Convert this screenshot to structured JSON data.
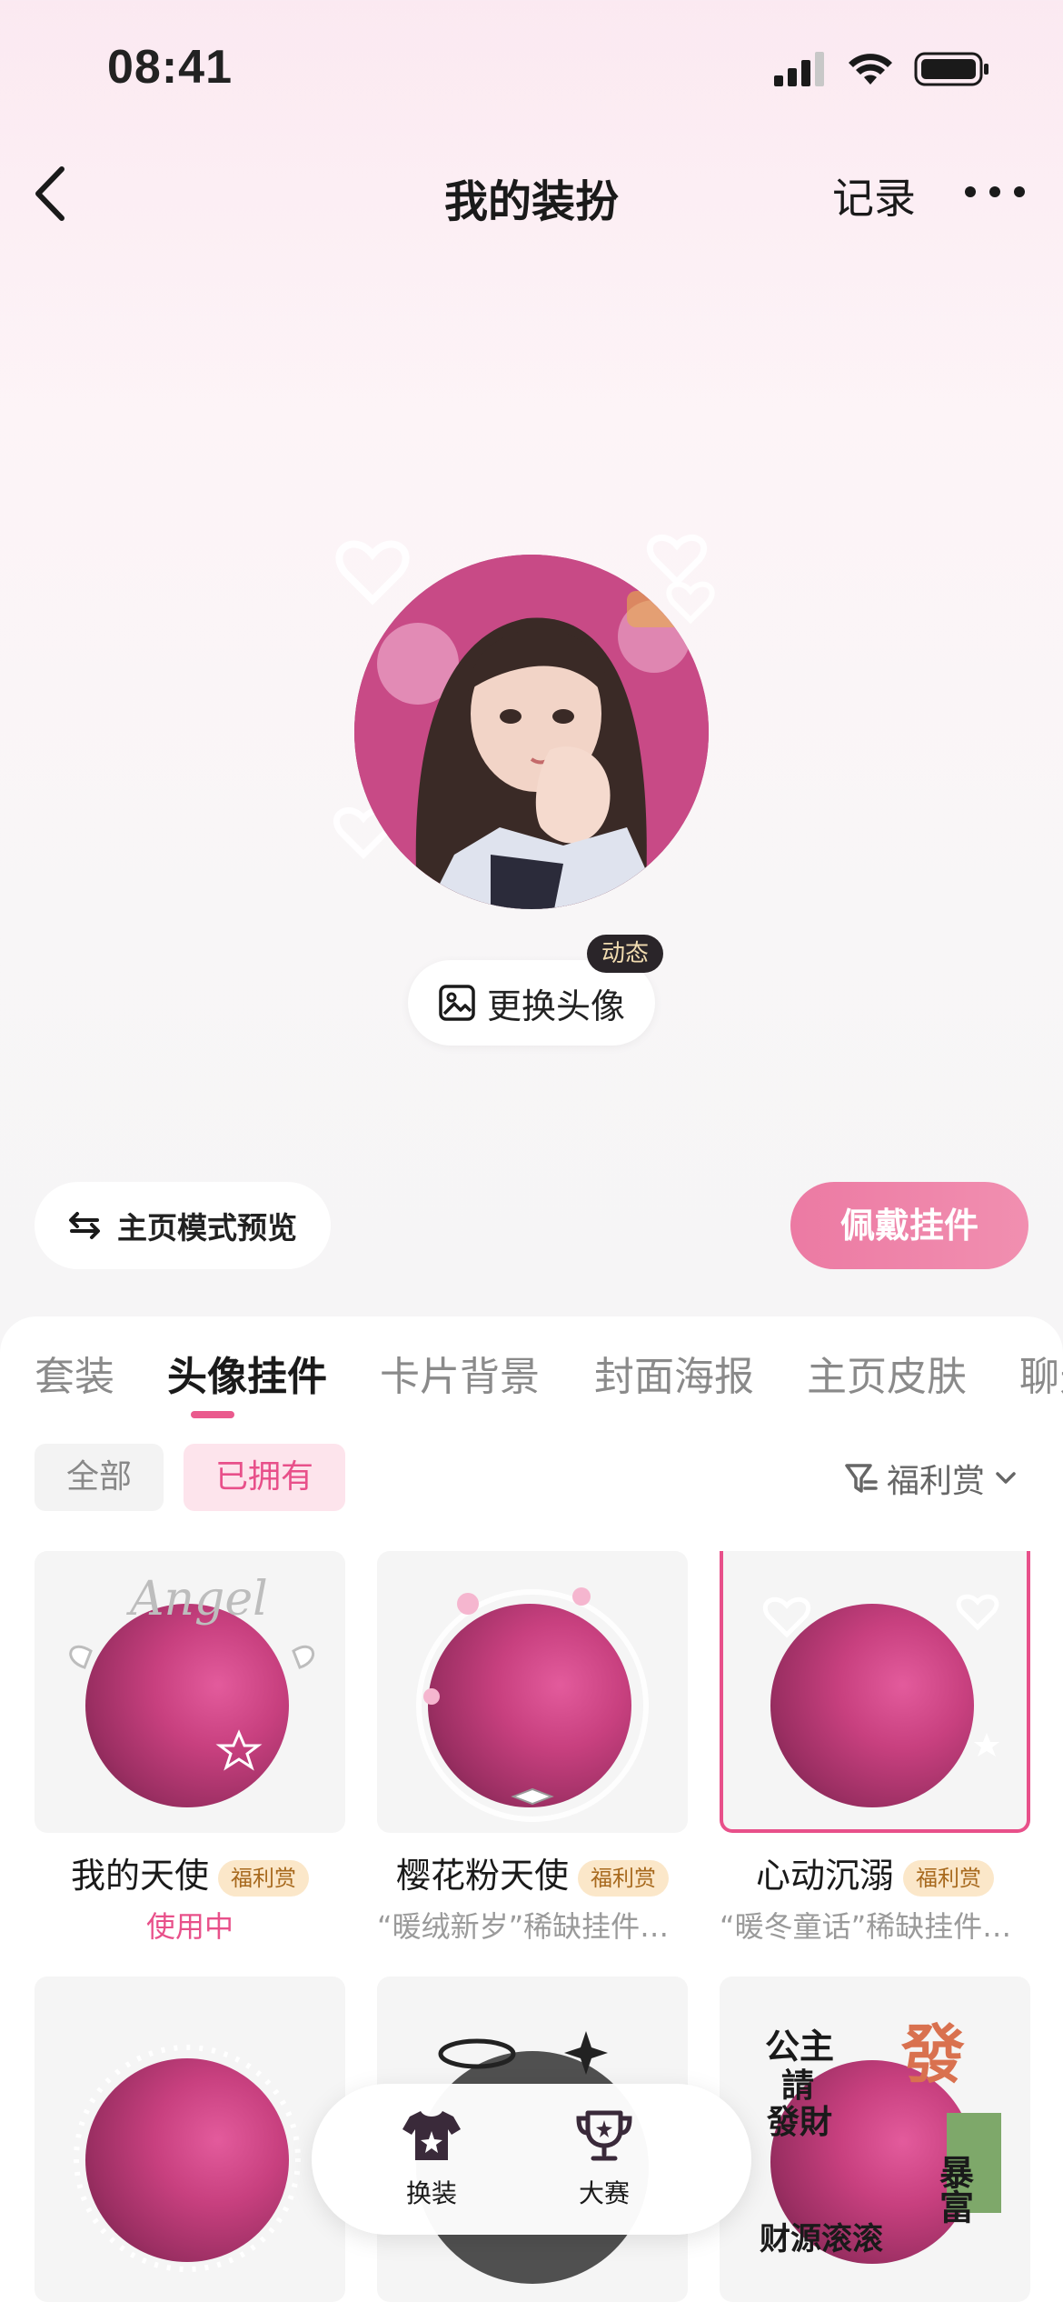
{
  "status_bar": {
    "time": "08:41"
  },
  "nav": {
    "title": "我的装扮",
    "records_label": "记录"
  },
  "avatar": {
    "change_label": "更换头像",
    "dynamic_badge": "动态"
  },
  "actions": {
    "preview_mode_label": "主页模式预览",
    "wear_label": "佩戴挂件"
  },
  "tabs": [
    "套装",
    "头像挂件",
    "卡片背景",
    "封面海报",
    "主页皮肤",
    "聊天"
  ],
  "active_tab": "头像挂件",
  "filters": {
    "all_label": "全部",
    "owned_label": "已拥有",
    "sort_label": "福利赏"
  },
  "items": [
    {
      "name": "我的天使",
      "badge": "福利赏",
      "sub": "使用中"
    },
    {
      "name": "樱花粉天使",
      "badge": "福利赏",
      "sub": "“暖绒新岁”稀缺挂件…"
    },
    {
      "name": "心动沉溺",
      "badge": "福利赏",
      "sub": "“暖冬童话”稀缺挂件…"
    }
  ],
  "decor_text": {
    "angel": "Angel",
    "fortune": [
      "公主",
      "請",
      "發財",
      "發",
      "暴富",
      "财源滚滚"
    ]
  },
  "bottom_bar": [
    {
      "label": "换装",
      "icon": "outfit-icon"
    },
    {
      "label": "大赛",
      "icon": "trophy-icon"
    }
  ],
  "colors": {
    "accent": "#e8508a",
    "wear_button": "#f08aae",
    "badge_bg": "#fbe7c9"
  }
}
